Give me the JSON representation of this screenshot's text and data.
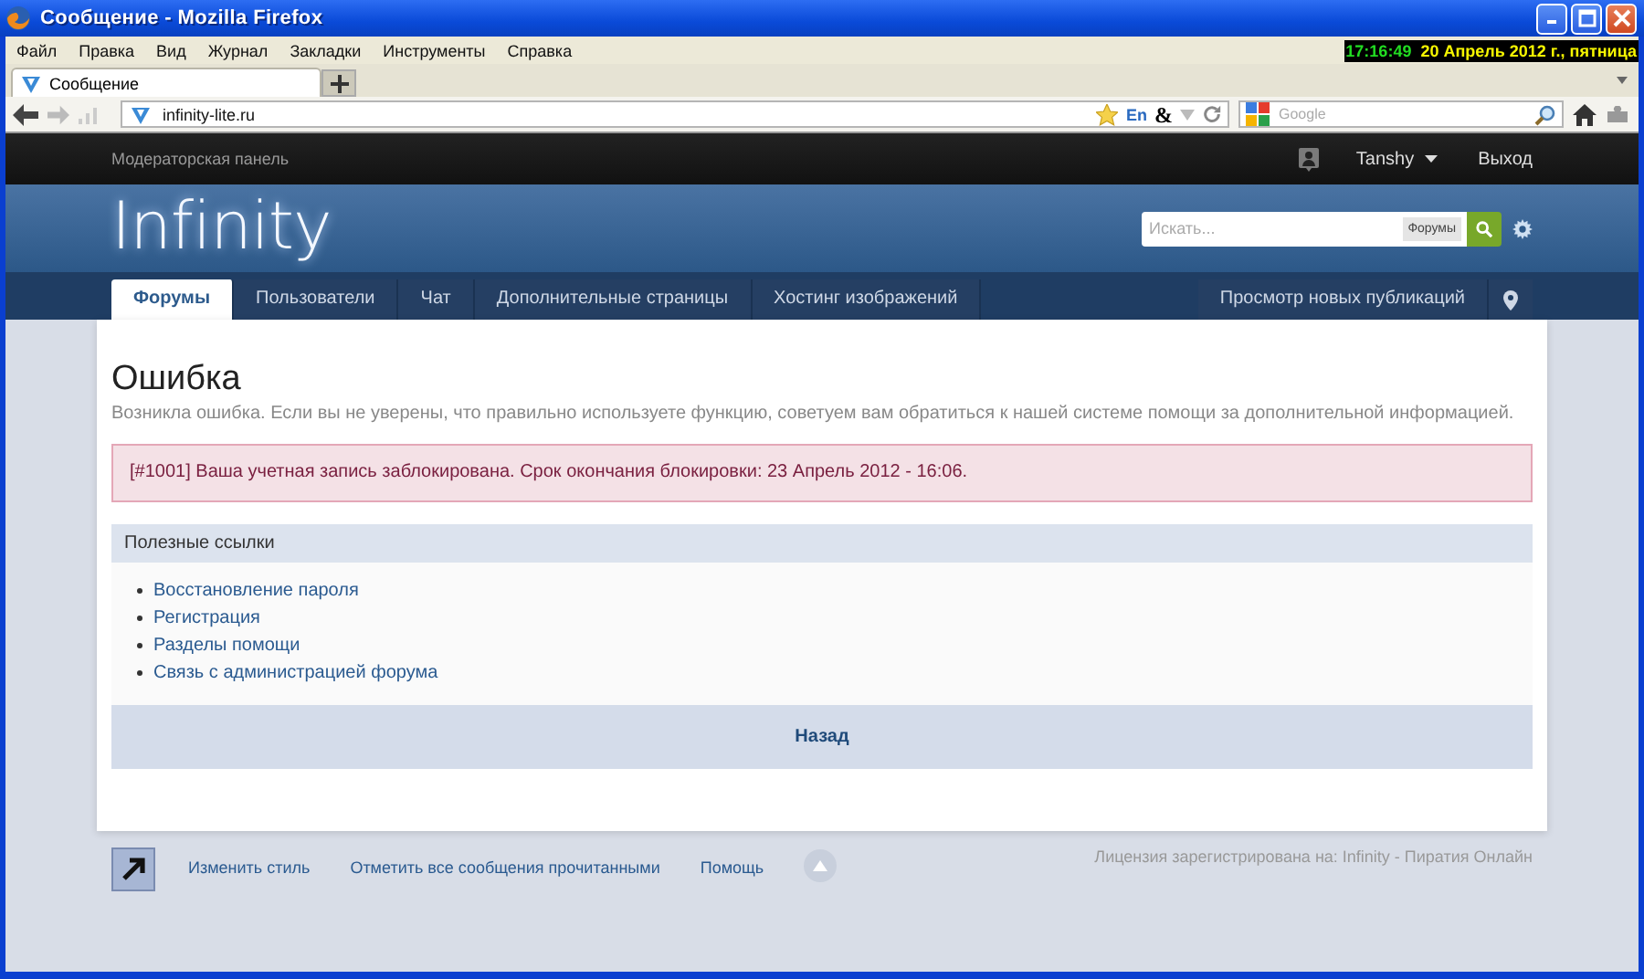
{
  "window": {
    "title": "Сообщение - Mozilla Firefox",
    "clock": "17:16:49",
    "date": "20 Апрель 2012 г., пятница"
  },
  "menu": [
    "Файл",
    "Правка",
    "Вид",
    "Журнал",
    "Закладки",
    "Инструменты",
    "Справка"
  ],
  "tabs": [
    {
      "label": "Сообщение",
      "selected": true
    }
  ],
  "address": {
    "value": "infinity-lite.ru",
    "lang": "En",
    "addon_glyph": "&"
  },
  "web_search": {
    "placeholder": "Google"
  },
  "site": {
    "mod_panel": "Модераторская панель",
    "user": "Tanshy",
    "logout": "Выход",
    "logo": "Infinity",
    "search": {
      "placeholder": "Искать...",
      "scope": "Форумы"
    },
    "nav": [
      {
        "label": "Форумы",
        "selected": true
      },
      {
        "label": "Пользователи",
        "selected": false
      },
      {
        "label": "Чат",
        "selected": false
      },
      {
        "label": "Дополнительные страницы",
        "selected": false
      },
      {
        "label": "Хостинг изображений",
        "selected": false
      }
    ],
    "new_posts": "Просмотр новых публикаций"
  },
  "error": {
    "title": "Ошибка",
    "description": "Возникла ошибка. Если вы не уверены, что правильно используете функцию, советуем вам обратиться к нашей системе помощи за дополнительной информацией.",
    "message": "[#1001] Ваша учетная запись заблокирована. Срок окончания блокировки: 23 Апрель 2012 - 16:06."
  },
  "links_panel": {
    "title": "Полезные ссылки",
    "links": [
      "Восстановление пароля",
      "Регистрация",
      "Разделы помощи",
      "Связь с администрацией форума"
    ],
    "back": "Назад"
  },
  "footer": {
    "links": [
      "Изменить стиль",
      "Отметить все сообщения прочитанными",
      "Помощь"
    ],
    "license": "Лицензия зарегистрирована на: Infinity - Пиратия Онлайн"
  }
}
